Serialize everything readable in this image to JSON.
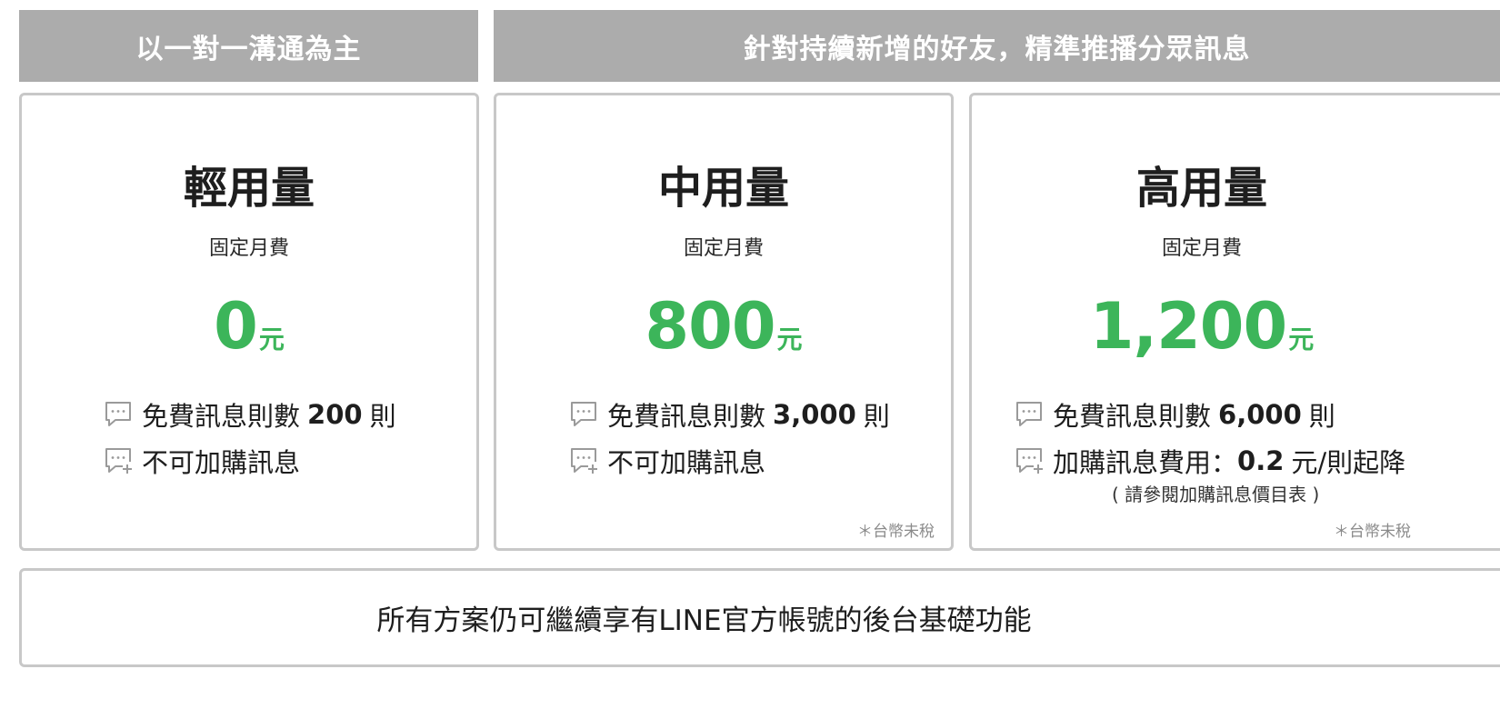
{
  "headers": {
    "left": "以一對一溝通為主",
    "right": "針對持續新增的好友，精準推播分眾訊息"
  },
  "plans": {
    "light": {
      "name": "輕用量",
      "fee_label": "固定月費",
      "price": "0",
      "unit": "元",
      "feature1_prefix": "免費訊息則數",
      "feature1_value": "200",
      "feature1_suffix": "則",
      "feature2": "不可加購訊息"
    },
    "medium": {
      "name": "中用量",
      "fee_label": "固定月費",
      "price": "800",
      "unit": "元",
      "feature1_prefix": "免費訊息則數",
      "feature1_value": "3,000",
      "feature1_suffix": "則",
      "feature2": "不可加購訊息",
      "tax_note": "＊台幣未稅"
    },
    "high": {
      "name": "高用量",
      "fee_label": "固定月費",
      "price": "1,200",
      "unit": "元",
      "feature1_prefix": "免費訊息則數",
      "feature1_value": "6,000",
      "feature1_suffix": "則",
      "feature2_prefix": "加購訊息費用：",
      "feature2_value": "0.2",
      "feature2_suffix": "元/則起降",
      "feature2_note": "( 請參閱加購訊息價目表 )",
      "tax_note": "＊台幣未稅"
    }
  },
  "footer": {
    "text": "所有方案仍可繼續享有LINE官方帳號的後台基礎功能"
  },
  "colors": {
    "accent_green": "#3cb55a",
    "header_gray": "#acacac",
    "border_gray": "#c8c8c8"
  },
  "icons": {
    "message_icon": "chat-bubble-dots-icon",
    "add_message_icon": "chat-bubble-plus-icon"
  }
}
